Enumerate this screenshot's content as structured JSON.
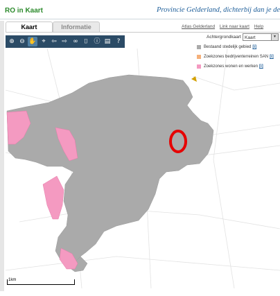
{
  "header": {
    "app_title": "RO in Kaart",
    "province": "Provincie Gelderland, dichterbij dan je denkt"
  },
  "tabs": [
    {
      "label": "Kaart",
      "active": true
    },
    {
      "label": "Informatie",
      "active": false
    }
  ],
  "top_links": [
    "Atlas Gelderland",
    "Link naar kaart",
    "Help"
  ],
  "toolbar": [
    {
      "icon": "zoom-in-icon"
    },
    {
      "icon": "zoom-out-icon"
    },
    {
      "icon": "pan-hand-icon",
      "selected": true
    },
    {
      "icon": "zoom-extent-icon"
    },
    {
      "icon": "back-arrow-icon"
    },
    {
      "icon": "forward-arrow-icon"
    },
    {
      "icon": "binoculars-icon"
    },
    {
      "icon": "measure-icon"
    },
    {
      "icon": "info-icon"
    },
    {
      "icon": "pdf-icon"
    },
    {
      "icon": "help-icon"
    }
  ],
  "background_map": {
    "label": "Achtergrondkaart",
    "selected": "Kaart"
  },
  "legend": [
    {
      "label": "Bestaand stedelijk gebied",
      "info": "[i]",
      "color": "#aaaaaa"
    },
    {
      "label": "Zoekzones bedrijventerreinen SAN",
      "info": "[i]",
      "color": "#f5b07a"
    },
    {
      "label": "Zoekzones wonen en werken",
      "info": "[i]",
      "color": "#f49ac1"
    }
  ],
  "scale": {
    "label": "1km"
  },
  "colors": {
    "urban": "#aaaaaa",
    "zoekzone_wonen": "#f49ac1",
    "marker": "#e60000",
    "toolbar_bg": "#2b4b66",
    "title_green": "#2c8a2c",
    "province_blue": "#1f5f9a"
  }
}
